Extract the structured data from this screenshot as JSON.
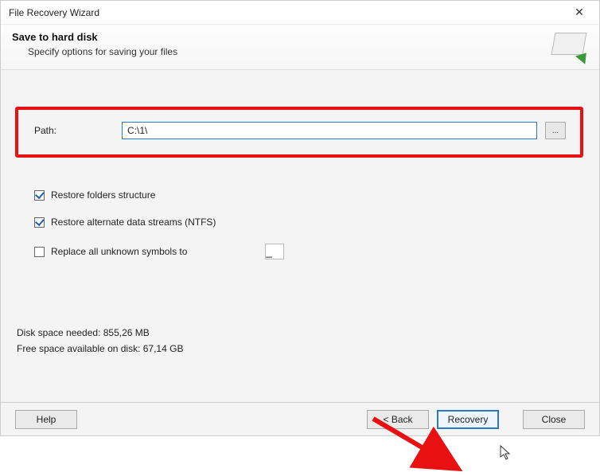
{
  "window": {
    "title": "File Recovery Wizard"
  },
  "header": {
    "heading": "Save to hard disk",
    "subtext": "Specify options for saving your files"
  },
  "path": {
    "label": "Path:",
    "value": "C:\\1\\"
  },
  "options": {
    "restore_folders": {
      "checked": true,
      "label": "Restore folders structure"
    },
    "restore_ads": {
      "checked": true,
      "label": "Restore alternate data streams (NTFS)"
    },
    "replace_unknown": {
      "checked": false,
      "label": "Replace all unknown symbols to",
      "value": "_"
    }
  },
  "diskinfo": {
    "needed": "Disk space needed: 855,26 MB",
    "free": "Free space available on disk: 67,14 GB"
  },
  "footer": {
    "help": "Help",
    "back": "< Back",
    "recovery": "Recovery",
    "close": "Close"
  },
  "icons": {
    "browse": "...",
    "close_x": "✕"
  }
}
